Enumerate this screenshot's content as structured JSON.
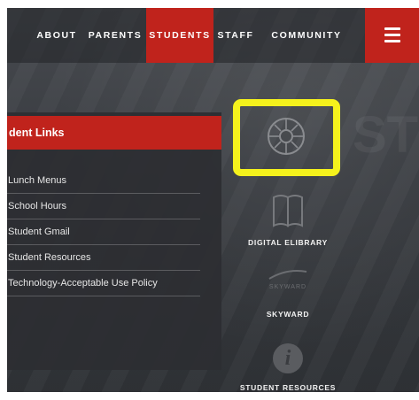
{
  "nav": {
    "items": [
      {
        "label": "ABOUT"
      },
      {
        "label": "PARENTS"
      },
      {
        "label": "STUDENTS",
        "active": true
      },
      {
        "label": "STAFF"
      },
      {
        "label": "COMMUNITY"
      }
    ],
    "menu_icon": "hamburger-menu-icon"
  },
  "panel": {
    "title": "dent Links",
    "links": [
      "Lunch Menus",
      "School Hours",
      "Student Gmail",
      "Student Resources",
      "Technology-Acceptable Use Policy"
    ]
  },
  "quick_links": [
    {
      "label": "",
      "icon": "canvas-logo-icon"
    },
    {
      "label": "DIGITAL ELIBRARY",
      "icon": "open-book-icon"
    },
    {
      "label": "SKYWARD",
      "icon": "skyward-logo-icon",
      "logo_text": "SKYWARD"
    },
    {
      "label": "STUDENT RESOURCES",
      "icon": "info-icon",
      "glyph": "i"
    }
  ],
  "background_word": "STUDENTS",
  "colors": {
    "accent_red": "#c0231c",
    "highlight_yellow": "#f5f21c",
    "background": "#3a3d42"
  }
}
